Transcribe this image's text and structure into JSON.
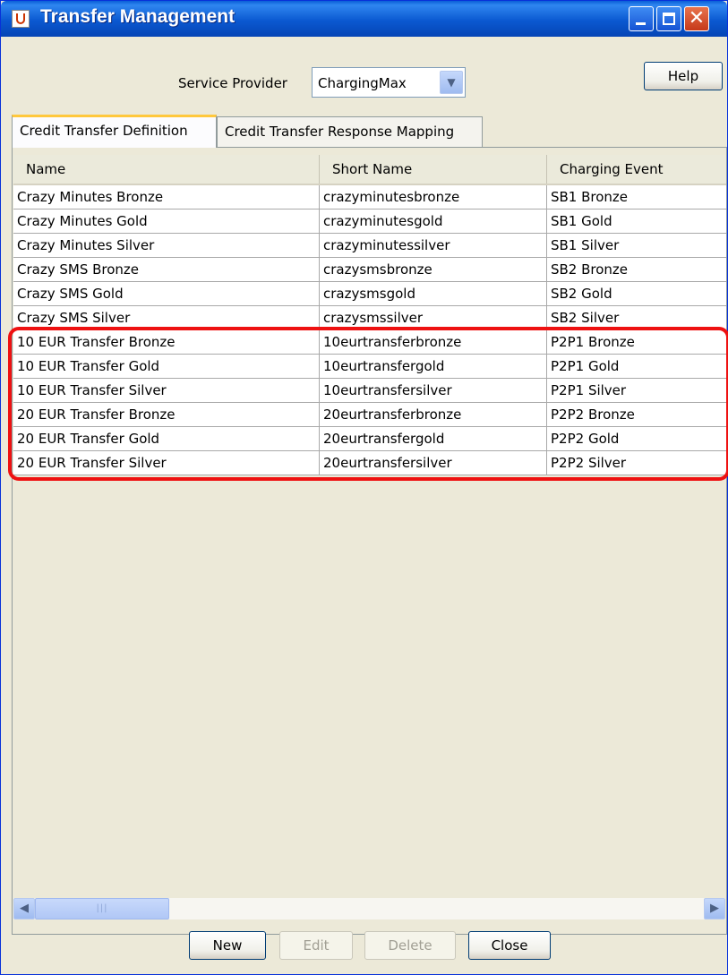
{
  "window": {
    "title": "Transfer Management",
    "close_glyph": "✕"
  },
  "service_provider": {
    "label": "Service Provider",
    "selected": "ChargingMax"
  },
  "help_button": {
    "label": "Help"
  },
  "tabs": [
    {
      "label": "Credit Transfer Definition",
      "active": true
    },
    {
      "label": "Credit Transfer Response Mapping",
      "active": false
    }
  ],
  "table": {
    "columns": [
      "Name",
      "Short Name",
      "Charging Event"
    ],
    "rows": [
      [
        "Crazy Minutes Bronze",
        "crazyminutesbronze",
        "SB1 Bronze"
      ],
      [
        "Crazy Minutes Gold",
        "crazyminutesgold",
        "SB1 Gold"
      ],
      [
        "Crazy Minutes Silver",
        "crazyminutessilver",
        "SB1 Silver"
      ],
      [
        "Crazy SMS Bronze",
        "crazysmsbronze",
        "SB2 Bronze"
      ],
      [
        "Crazy SMS Gold",
        "crazysmsgold",
        "SB2 Gold"
      ],
      [
        "Crazy SMS Silver",
        "crazysmssilver",
        "SB2 Silver"
      ],
      [
        "10 EUR Transfer Bronze",
        "10eurtransferbronze",
        "P2P1 Bronze"
      ],
      [
        "10 EUR Transfer Gold",
        "10eurtransfergold",
        "P2P1 Gold"
      ],
      [
        "10 EUR Transfer Silver",
        "10eurtransfersilver",
        "P2P1 Silver"
      ],
      [
        "20 EUR Transfer Bronze",
        "20eurtransferbronze",
        "P2P2 Bronze"
      ],
      [
        "20 EUR Transfer Gold",
        "20eurtransfergold",
        "P2P2 Gold"
      ],
      [
        "20 EUR Transfer Silver",
        "20eurtransfersilver",
        "P2P2 Silver"
      ]
    ]
  },
  "buttons": {
    "new": "New",
    "edit": "Edit",
    "delete": "Delete",
    "close": "Close"
  },
  "colors": {
    "highlight": "#ee1111",
    "titlebar": "#0b59d1",
    "window_bg": "#ece9d8"
  }
}
